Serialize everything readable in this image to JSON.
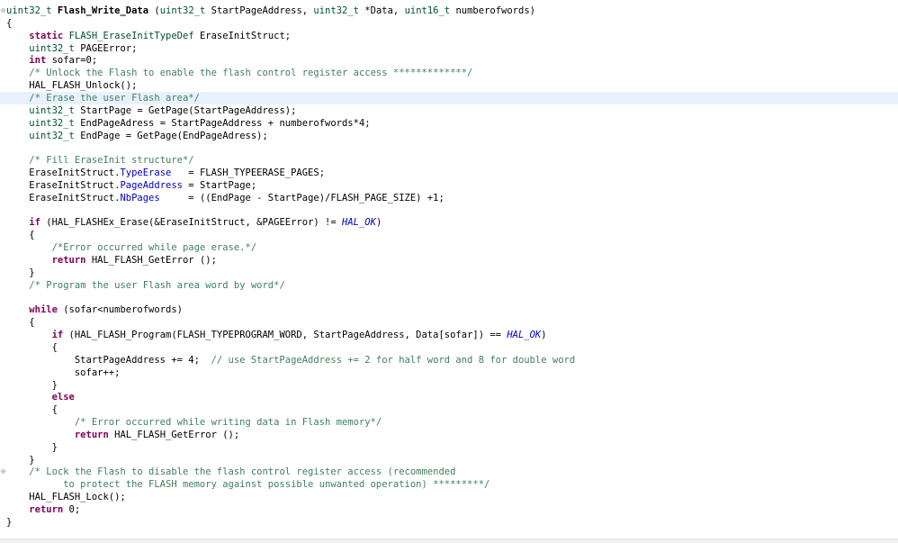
{
  "colors": {
    "keyword": "#7f0055",
    "type": "#005032",
    "comment": "#3f7f5f",
    "field": "#0000c0",
    "enum_constant": "#0000c0",
    "current_line_highlight": "#e8f2fe",
    "fold_marker": "#5a7aa8"
  },
  "editor": {
    "current_line": 7,
    "fold_markers": [
      {
        "line": 0,
        "icon": "collapse-icon",
        "glyph": "⊖"
      },
      {
        "line": 37,
        "icon": "collapse-icon",
        "glyph": "⊖"
      }
    ],
    "lines": [
      {
        "tokens": [
          {
            "t": "uint32_t",
            "k": "type"
          },
          {
            "t": " ",
            "k": "pl"
          },
          {
            "t": "Flash_Write_Data",
            "k": "fn"
          },
          {
            "t": " (",
            "k": "pl"
          },
          {
            "t": "uint32_t",
            "k": "type"
          },
          {
            "t": " StartPageAddress, ",
            "k": "pl"
          },
          {
            "t": "uint32_t",
            "k": "type"
          },
          {
            "t": " *Data, ",
            "k": "pl"
          },
          {
            "t": "uint16_t",
            "k": "type"
          },
          {
            "t": " numberofwords)",
            "k": "pl"
          }
        ]
      },
      {
        "tokens": [
          {
            "t": "{",
            "k": "pl"
          }
        ]
      },
      {
        "tokens": [
          {
            "t": "    ",
            "k": "pl"
          },
          {
            "t": "static",
            "k": "kw"
          },
          {
            "t": " ",
            "k": "pl"
          },
          {
            "t": "FLASH_EraseInitTypeDef",
            "k": "type"
          },
          {
            "t": " EraseInitStruct;",
            "k": "pl"
          }
        ]
      },
      {
        "tokens": [
          {
            "t": "    ",
            "k": "pl"
          },
          {
            "t": "uint32_t",
            "k": "type"
          },
          {
            "t": " PAGEError;",
            "k": "pl"
          }
        ]
      },
      {
        "tokens": [
          {
            "t": "    ",
            "k": "pl"
          },
          {
            "t": "int",
            "k": "kw"
          },
          {
            "t": " sofar=0;",
            "k": "pl"
          }
        ]
      },
      {
        "tokens": [
          {
            "t": "    ",
            "k": "pl"
          },
          {
            "t": "/* Unlock the Flash to enable the flash control register access *************/",
            "k": "cm"
          }
        ]
      },
      {
        "tokens": [
          {
            "t": "    HAL_FLASH_Unlock();",
            "k": "pl"
          }
        ]
      },
      {
        "tokens": [
          {
            "t": "    ",
            "k": "pl"
          },
          {
            "t": "/* Erase the user Flash area*/",
            "k": "cm"
          }
        ]
      },
      {
        "tokens": [
          {
            "t": "    ",
            "k": "pl"
          },
          {
            "t": "uint32_t",
            "k": "type"
          },
          {
            "t": " StartPage = GetPage(StartPageAddress);",
            "k": "pl"
          }
        ]
      },
      {
        "tokens": [
          {
            "t": "    ",
            "k": "pl"
          },
          {
            "t": "uint32_t",
            "k": "type"
          },
          {
            "t": " EndPageAdress = StartPageAddress + numberofwords*4;",
            "k": "pl"
          }
        ]
      },
      {
        "tokens": [
          {
            "t": "    ",
            "k": "pl"
          },
          {
            "t": "uint32_t",
            "k": "type"
          },
          {
            "t": " EndPage = GetPage(EndPageAdress);",
            "k": "pl"
          }
        ]
      },
      {
        "tokens": []
      },
      {
        "tokens": [
          {
            "t": "    ",
            "k": "pl"
          },
          {
            "t": "/* Fill EraseInit structure*/",
            "k": "cm"
          }
        ]
      },
      {
        "tokens": [
          {
            "t": "    EraseInitStruct.",
            "k": "pl"
          },
          {
            "t": "TypeErase",
            "k": "fld"
          },
          {
            "t": "   = FLASH_TYPEERASE_PAGES;",
            "k": "pl"
          }
        ]
      },
      {
        "tokens": [
          {
            "t": "    EraseInitStruct.",
            "k": "pl"
          },
          {
            "t": "PageAddress",
            "k": "fld"
          },
          {
            "t": " = StartPage;",
            "k": "pl"
          }
        ]
      },
      {
        "tokens": [
          {
            "t": "    EraseInitStruct.",
            "k": "pl"
          },
          {
            "t": "NbPages",
            "k": "fld"
          },
          {
            "t": "     = ((EndPage - StartPage)/FLASH_PAGE_SIZE) +1;",
            "k": "pl"
          }
        ]
      },
      {
        "tokens": []
      },
      {
        "tokens": [
          {
            "t": "    ",
            "k": "pl"
          },
          {
            "t": "if",
            "k": "kw"
          },
          {
            "t": " (HAL_FLASHEx_Erase(&EraseInitStruct, &PAGEError) != ",
            "k": "pl"
          },
          {
            "t": "HAL_OK",
            "k": "en"
          },
          {
            "t": ")",
            "k": "pl"
          }
        ]
      },
      {
        "tokens": [
          {
            "t": "    {",
            "k": "pl"
          }
        ]
      },
      {
        "tokens": [
          {
            "t": "        ",
            "k": "pl"
          },
          {
            "t": "/*Error occurred while page erase.*/",
            "k": "cm"
          }
        ]
      },
      {
        "tokens": [
          {
            "t": "        ",
            "k": "pl"
          },
          {
            "t": "return",
            "k": "kw"
          },
          {
            "t": " HAL_FLASH_GetError ();",
            "k": "pl"
          }
        ]
      },
      {
        "tokens": [
          {
            "t": "    }",
            "k": "pl"
          }
        ]
      },
      {
        "tokens": [
          {
            "t": "    ",
            "k": "pl"
          },
          {
            "t": "/* Program the user Flash area word by word*/",
            "k": "cm"
          }
        ]
      },
      {
        "tokens": []
      },
      {
        "tokens": [
          {
            "t": "    ",
            "k": "pl"
          },
          {
            "t": "while",
            "k": "kw"
          },
          {
            "t": " (sofar<numberofwords)",
            "k": "pl"
          }
        ]
      },
      {
        "tokens": [
          {
            "t": "    {",
            "k": "pl"
          }
        ]
      },
      {
        "tokens": [
          {
            "t": "        ",
            "k": "pl"
          },
          {
            "t": "if",
            "k": "kw"
          },
          {
            "t": " (HAL_FLASH_Program(FLASH_TYPEPROGRAM_WORD, StartPageAddress, Data[sofar]) == ",
            "k": "pl"
          },
          {
            "t": "HAL_OK",
            "k": "en"
          },
          {
            "t": ")",
            "k": "pl"
          }
        ]
      },
      {
        "tokens": [
          {
            "t": "        {",
            "k": "pl"
          }
        ]
      },
      {
        "tokens": [
          {
            "t": "            StartPageAddress += 4;  ",
            "k": "pl"
          },
          {
            "t": "// use StartPageAddress += 2 for half word and 8 for double word",
            "k": "cm"
          }
        ]
      },
      {
        "tokens": [
          {
            "t": "            sofar++;",
            "k": "pl"
          }
        ]
      },
      {
        "tokens": [
          {
            "t": "        }",
            "k": "pl"
          }
        ]
      },
      {
        "tokens": [
          {
            "t": "        ",
            "k": "pl"
          },
          {
            "t": "else",
            "k": "kw"
          }
        ]
      },
      {
        "tokens": [
          {
            "t": "        {",
            "k": "pl"
          }
        ]
      },
      {
        "tokens": [
          {
            "t": "            ",
            "k": "pl"
          },
          {
            "t": "/* Error occurred while writing data in Flash memory*/",
            "k": "cm"
          }
        ]
      },
      {
        "tokens": [
          {
            "t": "            ",
            "k": "pl"
          },
          {
            "t": "return",
            "k": "kw"
          },
          {
            "t": " HAL_FLASH_GetError ();",
            "k": "pl"
          }
        ]
      },
      {
        "tokens": [
          {
            "t": "        }",
            "k": "pl"
          }
        ]
      },
      {
        "tokens": [
          {
            "t": "    }",
            "k": "pl"
          }
        ]
      },
      {
        "tokens": [
          {
            "t": "    ",
            "k": "pl"
          },
          {
            "t": "/* Lock the Flash to disable the flash control register access (recommended",
            "k": "cm"
          }
        ]
      },
      {
        "tokens": [
          {
            "t": "          ",
            "k": "pl"
          },
          {
            "t": "to protect the FLASH memory against possible unwanted operation) *********/",
            "k": "cm"
          }
        ]
      },
      {
        "tokens": [
          {
            "t": "    HAL_FLASH_Lock();",
            "k": "pl"
          }
        ]
      },
      {
        "tokens": [
          {
            "t": "    ",
            "k": "pl"
          },
          {
            "t": "return",
            "k": "kw"
          },
          {
            "t": " 0;",
            "k": "pl"
          }
        ]
      },
      {
        "tokens": [
          {
            "t": "}",
            "k": "pl"
          }
        ]
      }
    ]
  }
}
